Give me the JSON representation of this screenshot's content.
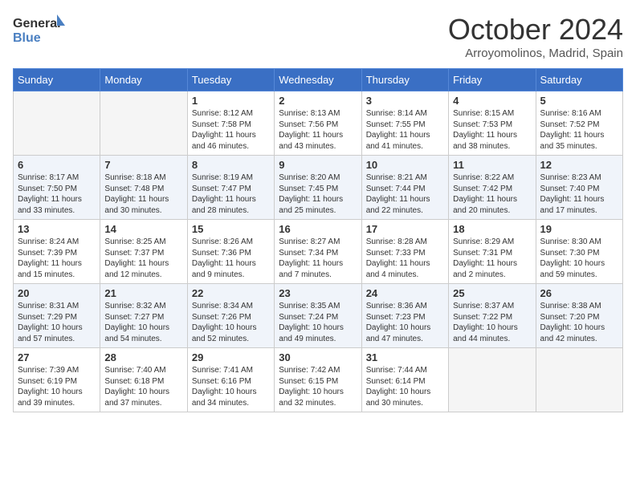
{
  "header": {
    "logo_general": "General",
    "logo_blue": "Blue",
    "month_title": "October 2024",
    "subtitle": "Arroyomolinos, Madrid, Spain"
  },
  "weekdays": [
    "Sunday",
    "Monday",
    "Tuesday",
    "Wednesday",
    "Thursday",
    "Friday",
    "Saturday"
  ],
  "weeks": [
    [
      {
        "day": "",
        "sunrise": "",
        "sunset": "",
        "daylight": "",
        "empty": true
      },
      {
        "day": "",
        "sunrise": "",
        "sunset": "",
        "daylight": "",
        "empty": true
      },
      {
        "day": "1",
        "sunrise": "Sunrise: 8:12 AM",
        "sunset": "Sunset: 7:58 PM",
        "daylight": "Daylight: 11 hours and 46 minutes."
      },
      {
        "day": "2",
        "sunrise": "Sunrise: 8:13 AM",
        "sunset": "Sunset: 7:56 PM",
        "daylight": "Daylight: 11 hours and 43 minutes."
      },
      {
        "day": "3",
        "sunrise": "Sunrise: 8:14 AM",
        "sunset": "Sunset: 7:55 PM",
        "daylight": "Daylight: 11 hours and 41 minutes."
      },
      {
        "day": "4",
        "sunrise": "Sunrise: 8:15 AM",
        "sunset": "Sunset: 7:53 PM",
        "daylight": "Daylight: 11 hours and 38 minutes."
      },
      {
        "day": "5",
        "sunrise": "Sunrise: 8:16 AM",
        "sunset": "Sunset: 7:52 PM",
        "daylight": "Daylight: 11 hours and 35 minutes."
      }
    ],
    [
      {
        "day": "6",
        "sunrise": "Sunrise: 8:17 AM",
        "sunset": "Sunset: 7:50 PM",
        "daylight": "Daylight: 11 hours and 33 minutes."
      },
      {
        "day": "7",
        "sunrise": "Sunrise: 8:18 AM",
        "sunset": "Sunset: 7:48 PM",
        "daylight": "Daylight: 11 hours and 30 minutes."
      },
      {
        "day": "8",
        "sunrise": "Sunrise: 8:19 AM",
        "sunset": "Sunset: 7:47 PM",
        "daylight": "Daylight: 11 hours and 28 minutes."
      },
      {
        "day": "9",
        "sunrise": "Sunrise: 8:20 AM",
        "sunset": "Sunset: 7:45 PM",
        "daylight": "Daylight: 11 hours and 25 minutes."
      },
      {
        "day": "10",
        "sunrise": "Sunrise: 8:21 AM",
        "sunset": "Sunset: 7:44 PM",
        "daylight": "Daylight: 11 hours and 22 minutes."
      },
      {
        "day": "11",
        "sunrise": "Sunrise: 8:22 AM",
        "sunset": "Sunset: 7:42 PM",
        "daylight": "Daylight: 11 hours and 20 minutes."
      },
      {
        "day": "12",
        "sunrise": "Sunrise: 8:23 AM",
        "sunset": "Sunset: 7:40 PM",
        "daylight": "Daylight: 11 hours and 17 minutes."
      }
    ],
    [
      {
        "day": "13",
        "sunrise": "Sunrise: 8:24 AM",
        "sunset": "Sunset: 7:39 PM",
        "daylight": "Daylight: 11 hours and 15 minutes."
      },
      {
        "day": "14",
        "sunrise": "Sunrise: 8:25 AM",
        "sunset": "Sunset: 7:37 PM",
        "daylight": "Daylight: 11 hours and 12 minutes."
      },
      {
        "day": "15",
        "sunrise": "Sunrise: 8:26 AM",
        "sunset": "Sunset: 7:36 PM",
        "daylight": "Daylight: 11 hours and 9 minutes."
      },
      {
        "day": "16",
        "sunrise": "Sunrise: 8:27 AM",
        "sunset": "Sunset: 7:34 PM",
        "daylight": "Daylight: 11 hours and 7 minutes."
      },
      {
        "day": "17",
        "sunrise": "Sunrise: 8:28 AM",
        "sunset": "Sunset: 7:33 PM",
        "daylight": "Daylight: 11 hours and 4 minutes."
      },
      {
        "day": "18",
        "sunrise": "Sunrise: 8:29 AM",
        "sunset": "Sunset: 7:31 PM",
        "daylight": "Daylight: 11 hours and 2 minutes."
      },
      {
        "day": "19",
        "sunrise": "Sunrise: 8:30 AM",
        "sunset": "Sunset: 7:30 PM",
        "daylight": "Daylight: 10 hours and 59 minutes."
      }
    ],
    [
      {
        "day": "20",
        "sunrise": "Sunrise: 8:31 AM",
        "sunset": "Sunset: 7:29 PM",
        "daylight": "Daylight: 10 hours and 57 minutes."
      },
      {
        "day": "21",
        "sunrise": "Sunrise: 8:32 AM",
        "sunset": "Sunset: 7:27 PM",
        "daylight": "Daylight: 10 hours and 54 minutes."
      },
      {
        "day": "22",
        "sunrise": "Sunrise: 8:34 AM",
        "sunset": "Sunset: 7:26 PM",
        "daylight": "Daylight: 10 hours and 52 minutes."
      },
      {
        "day": "23",
        "sunrise": "Sunrise: 8:35 AM",
        "sunset": "Sunset: 7:24 PM",
        "daylight": "Daylight: 10 hours and 49 minutes."
      },
      {
        "day": "24",
        "sunrise": "Sunrise: 8:36 AM",
        "sunset": "Sunset: 7:23 PM",
        "daylight": "Daylight: 10 hours and 47 minutes."
      },
      {
        "day": "25",
        "sunrise": "Sunrise: 8:37 AM",
        "sunset": "Sunset: 7:22 PM",
        "daylight": "Daylight: 10 hours and 44 minutes."
      },
      {
        "day": "26",
        "sunrise": "Sunrise: 8:38 AM",
        "sunset": "Sunset: 7:20 PM",
        "daylight": "Daylight: 10 hours and 42 minutes."
      }
    ],
    [
      {
        "day": "27",
        "sunrise": "Sunrise: 7:39 AM",
        "sunset": "Sunset: 6:19 PM",
        "daylight": "Daylight: 10 hours and 39 minutes."
      },
      {
        "day": "28",
        "sunrise": "Sunrise: 7:40 AM",
        "sunset": "Sunset: 6:18 PM",
        "daylight": "Daylight: 10 hours and 37 minutes."
      },
      {
        "day": "29",
        "sunrise": "Sunrise: 7:41 AM",
        "sunset": "Sunset: 6:16 PM",
        "daylight": "Daylight: 10 hours and 34 minutes."
      },
      {
        "day": "30",
        "sunrise": "Sunrise: 7:42 AM",
        "sunset": "Sunset: 6:15 PM",
        "daylight": "Daylight: 10 hours and 32 minutes."
      },
      {
        "day": "31",
        "sunrise": "Sunrise: 7:44 AM",
        "sunset": "Sunset: 6:14 PM",
        "daylight": "Daylight: 10 hours and 30 minutes."
      },
      {
        "day": "",
        "sunrise": "",
        "sunset": "",
        "daylight": "",
        "empty": true
      },
      {
        "day": "",
        "sunrise": "",
        "sunset": "",
        "daylight": "",
        "empty": true
      }
    ]
  ]
}
